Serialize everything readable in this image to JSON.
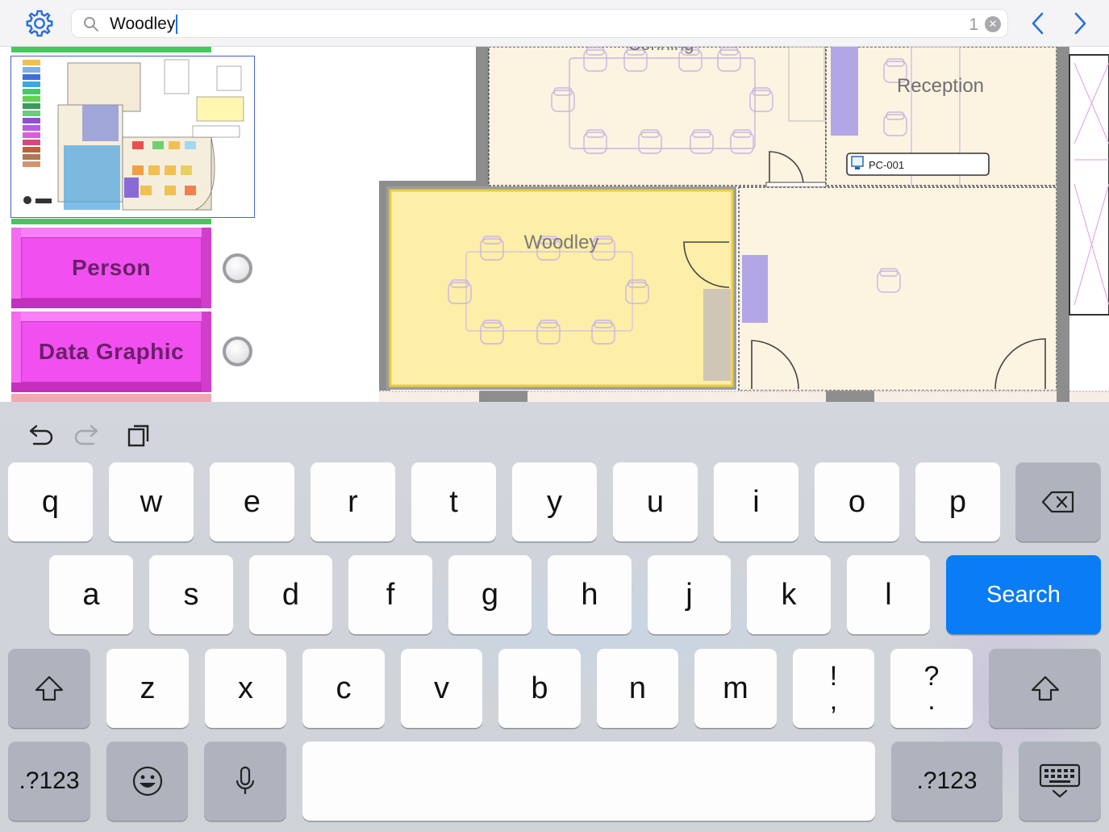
{
  "search": {
    "value": "Woodley",
    "match_count": "1"
  },
  "floorplan": {
    "room_top_label": "Sonning",
    "room_reception_label": "Reception",
    "room_woodley_label": "Woodley",
    "device_label": "PC-001"
  },
  "panel": {
    "person_label": "Person",
    "data_graphic_label": "Data Graphic"
  },
  "keyboard": {
    "row1": [
      "q",
      "w",
      "e",
      "r",
      "t",
      "y",
      "u",
      "i",
      "o",
      "p"
    ],
    "row2": [
      "a",
      "s",
      "d",
      "f",
      "g",
      "h",
      "j",
      "k",
      "l"
    ],
    "row3": [
      "z",
      "x",
      "c",
      "v",
      "b",
      "n",
      "m"
    ],
    "punct1_top": "!",
    "punct1_bottom": ",",
    "punct2_top": "?",
    "punct2_bottom": ".",
    "search_label": "Search",
    "numbers_label_left": ".?123",
    "numbers_label_right": ".?123"
  },
  "colors": {
    "accent_blue": "#0a7cf5",
    "magenta_button": "#f14ff0",
    "highlight_room": "#fdeea8",
    "room_fill": "#fdf3e1"
  },
  "icons": {
    "settings": "gear-icon",
    "search": "search-icon",
    "clear": "clear-icon",
    "prev": "chevron-left-icon",
    "next": "chevron-right-icon",
    "undo": "undo-icon",
    "redo": "redo-icon",
    "paste": "paste-icon",
    "backspace": "backspace-icon",
    "shift": "shift-icon",
    "emoji": "emoji-icon",
    "dictation": "microphone-icon",
    "dismiss": "keyboard-dismiss-icon"
  }
}
